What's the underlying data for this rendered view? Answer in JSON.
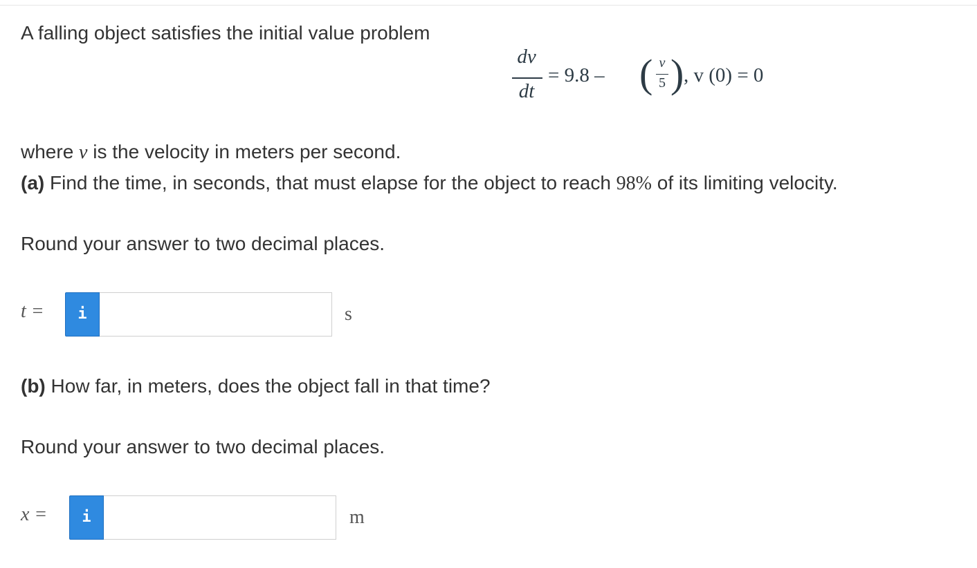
{
  "problem": {
    "intro": "A falling object satisfies the initial value problem",
    "equation": {
      "dv": "dv",
      "dt": "dt",
      "rhs": "= 9.8 –",
      "paren_open": "(",
      "v": "v",
      "five": "5",
      "paren_close": ")",
      "tail": ",  v (0) = 0"
    },
    "where_prefix": "where ",
    "where_var": "v",
    "where_suffix": " is the velocity in meters per second."
  },
  "part_a": {
    "label": "(a)",
    "text_before": " Find the time, in seconds, that must elapse for the object to reach ",
    "percent": "98%",
    "text_after": " of its limiting velocity.",
    "round_note": "Round your answer to two decimal places.",
    "var_label": "t =",
    "info_icon": "i",
    "input_value": "",
    "unit": "s"
  },
  "part_b": {
    "label": "(b)",
    "text": " How far, in meters, does the object fall in that time?",
    "round_note": "Round your answer to two decimal places.",
    "var_label": "x =",
    "info_icon": "i",
    "input_value": "",
    "unit": "m"
  }
}
